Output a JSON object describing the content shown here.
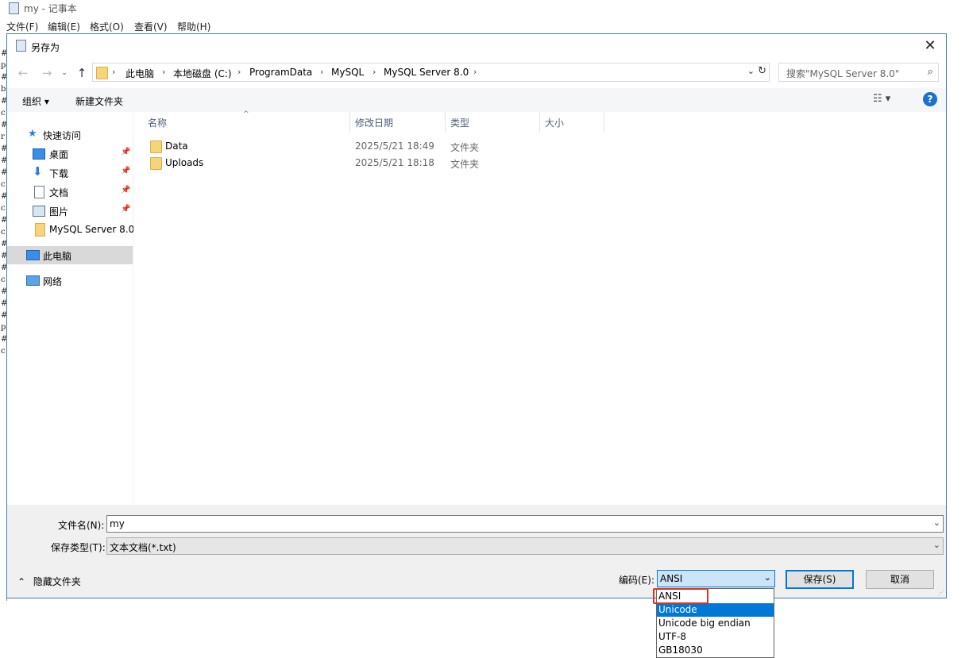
{
  "notepad": {
    "title": "my - 记事本",
    "menu": [
      "文件(F)",
      "编辑(E)",
      "格式(O)",
      "查看(V)",
      "帮助(H)"
    ],
    "edge_chars": [
      "#",
      "p",
      "#",
      "b",
      "#",
      "c",
      "#",
      "r",
      "#",
      "#",
      "#",
      "c",
      "#",
      "c",
      "#",
      "c",
      "#",
      "#",
      "#",
      "c",
      "#",
      "#",
      "#",
      "p",
      "#",
      "c"
    ]
  },
  "dialog": {
    "title": "另存为",
    "close": "✕",
    "address": {
      "crumbs": [
        "此电脑",
        "本地磁盘 (C:)",
        "ProgramData",
        "MySQL",
        "MySQL Server 8.0"
      ],
      "separator": "›"
    },
    "search_placeholder": "搜索\"MySQL Server 8.0\"",
    "toolbar": {
      "organize": "组织 ▾",
      "new_folder": "新建文件夹",
      "help": "?"
    },
    "sidebar": [
      {
        "label": "快速访问",
        "icon": "star-icon",
        "pinned": false
      },
      {
        "label": "桌面",
        "icon": "desktop-icon",
        "pinned": true
      },
      {
        "label": "下载",
        "icon": "download-icon",
        "pinned": true
      },
      {
        "label": "文档",
        "icon": "document-icon",
        "pinned": true
      },
      {
        "label": "图片",
        "icon": "pictures-icon",
        "pinned": true
      },
      {
        "label": "MySQL Server 8.0",
        "icon": "folder-icon",
        "pinned": false
      },
      {
        "label": "此电脑",
        "icon": "computer-icon",
        "pinned": false,
        "selected": true
      },
      {
        "label": "网络",
        "icon": "network-icon",
        "pinned": false
      }
    ],
    "columns": [
      "名称",
      "修改日期",
      "类型",
      "大小"
    ],
    "files": [
      {
        "name": "Data",
        "modified": "2025/5/21 18:49",
        "type": "文件夹"
      },
      {
        "name": "Uploads",
        "modified": "2025/5/21 18:18",
        "type": "文件夹"
      }
    ],
    "filename_label": "文件名(N):",
    "filename_value": "my",
    "filetype_label": "保存类型(T):",
    "filetype_value": "文本文档(*.txt)",
    "hide_folders": "隐藏文件夹",
    "encoding_label": "编码(E):",
    "encoding_value": "ANSI",
    "save_button": "保存(S)",
    "cancel_button": "取消",
    "encoding_options": [
      "ANSI",
      "Unicode",
      "Unicode big endian",
      "UTF-8",
      "GB18030"
    ],
    "highlighted_option": "Unicode"
  },
  "colors": {
    "accent": "#0078d7",
    "annotation": "#e0301e",
    "folder": "#f6d47a"
  }
}
